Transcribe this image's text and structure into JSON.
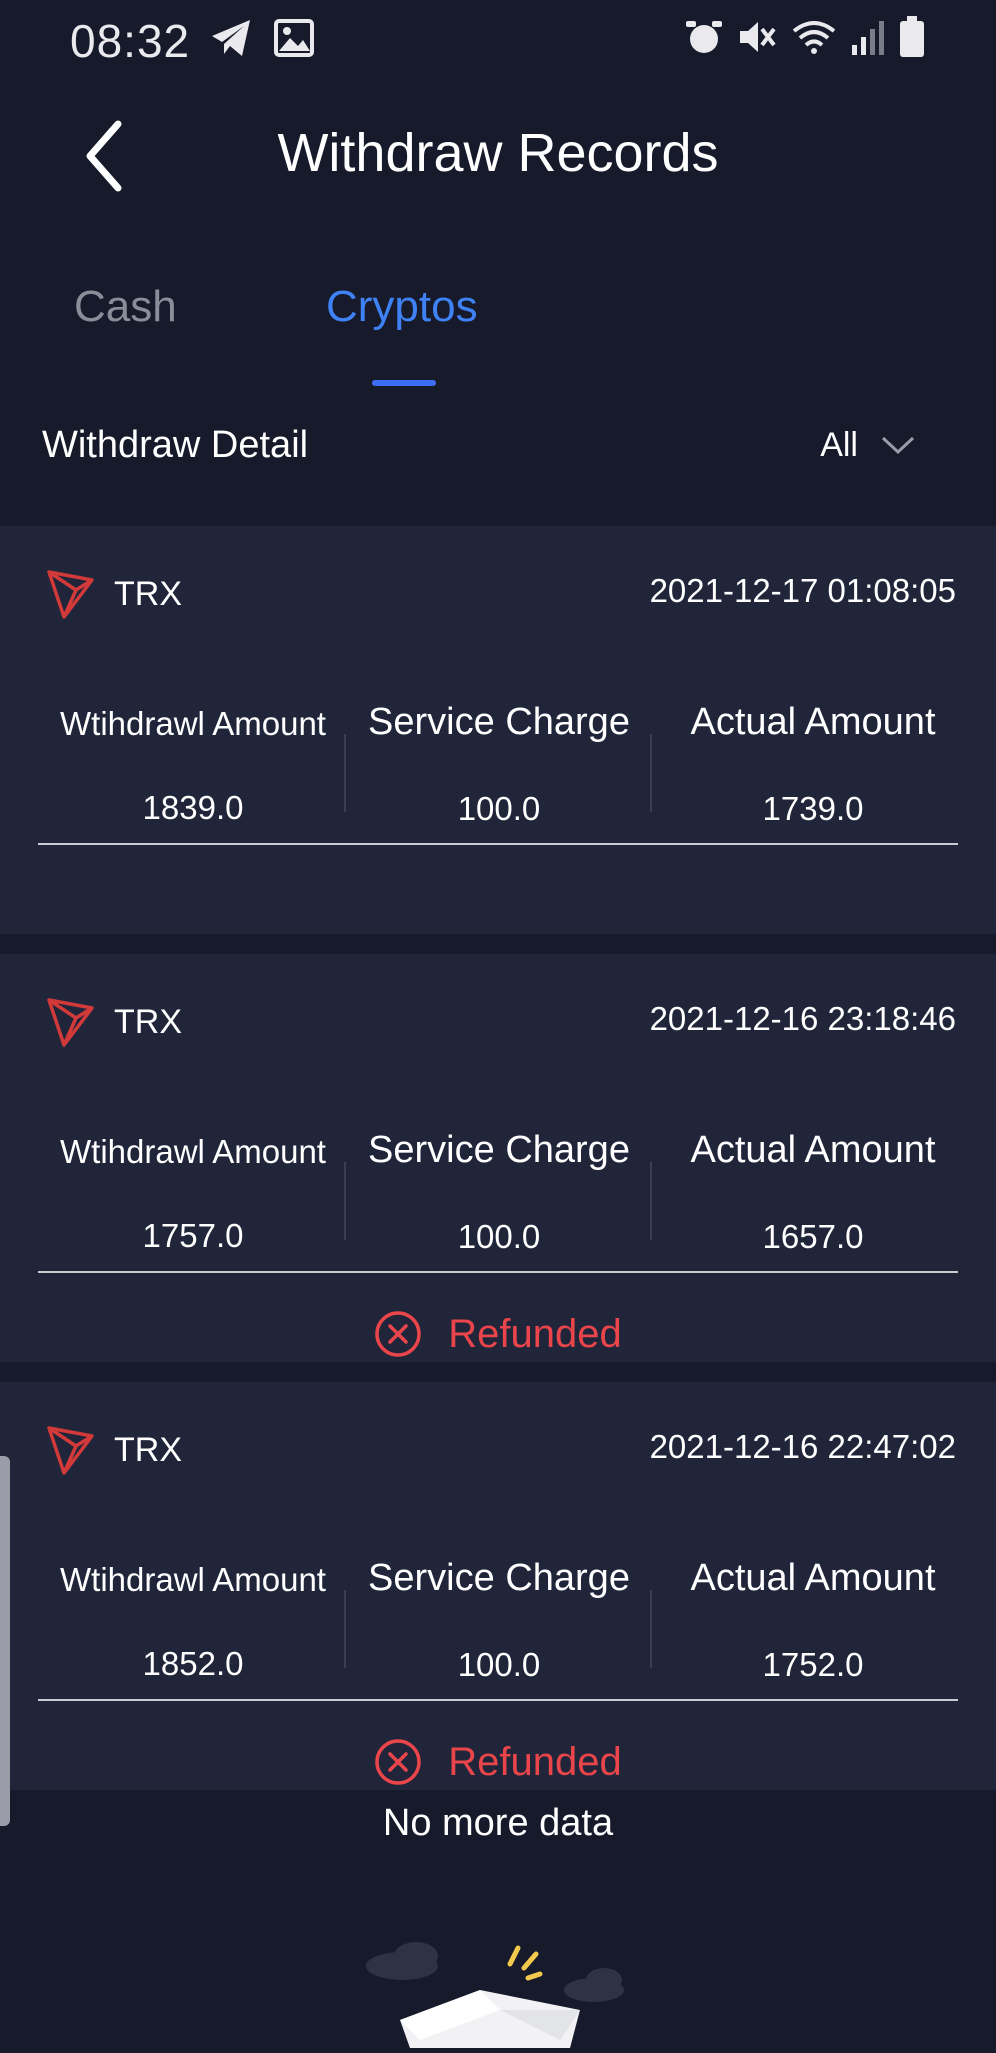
{
  "status_bar": {
    "time": "08:32"
  },
  "header": {
    "title": "Withdraw Records"
  },
  "tabs": [
    {
      "label": "Cash",
      "active": false
    },
    {
      "label": "Cryptos",
      "active": true
    }
  ],
  "filter": {
    "title": "Withdraw Detail",
    "selected": "All"
  },
  "columns": {
    "withdrawal": "Wtihdrawl Amount",
    "charge": "Service Charge",
    "actual": "Actual Amount"
  },
  "records": [
    {
      "coin": "TRX",
      "datetime": "2021-12-17 01:08:05",
      "withdrawal": "1839.0",
      "charge": "100.0",
      "actual": "1739.0",
      "status": ""
    },
    {
      "coin": "TRX",
      "datetime": "2021-12-16 23:18:46",
      "withdrawal": "1757.0",
      "charge": "100.0",
      "actual": "1657.0",
      "status": "Refunded"
    },
    {
      "coin": "TRX",
      "datetime": "2021-12-16 22:47:02",
      "withdrawal": "1852.0",
      "charge": "100.0",
      "actual": "1752.0",
      "status": "Refunded"
    }
  ],
  "footer": {
    "no_more": "No more data"
  },
  "colors": {
    "background": "#161a2b",
    "card": "#21253a",
    "accent": "#3e82f5",
    "refund": "#e9454b",
    "tron": "#d23a3a"
  }
}
